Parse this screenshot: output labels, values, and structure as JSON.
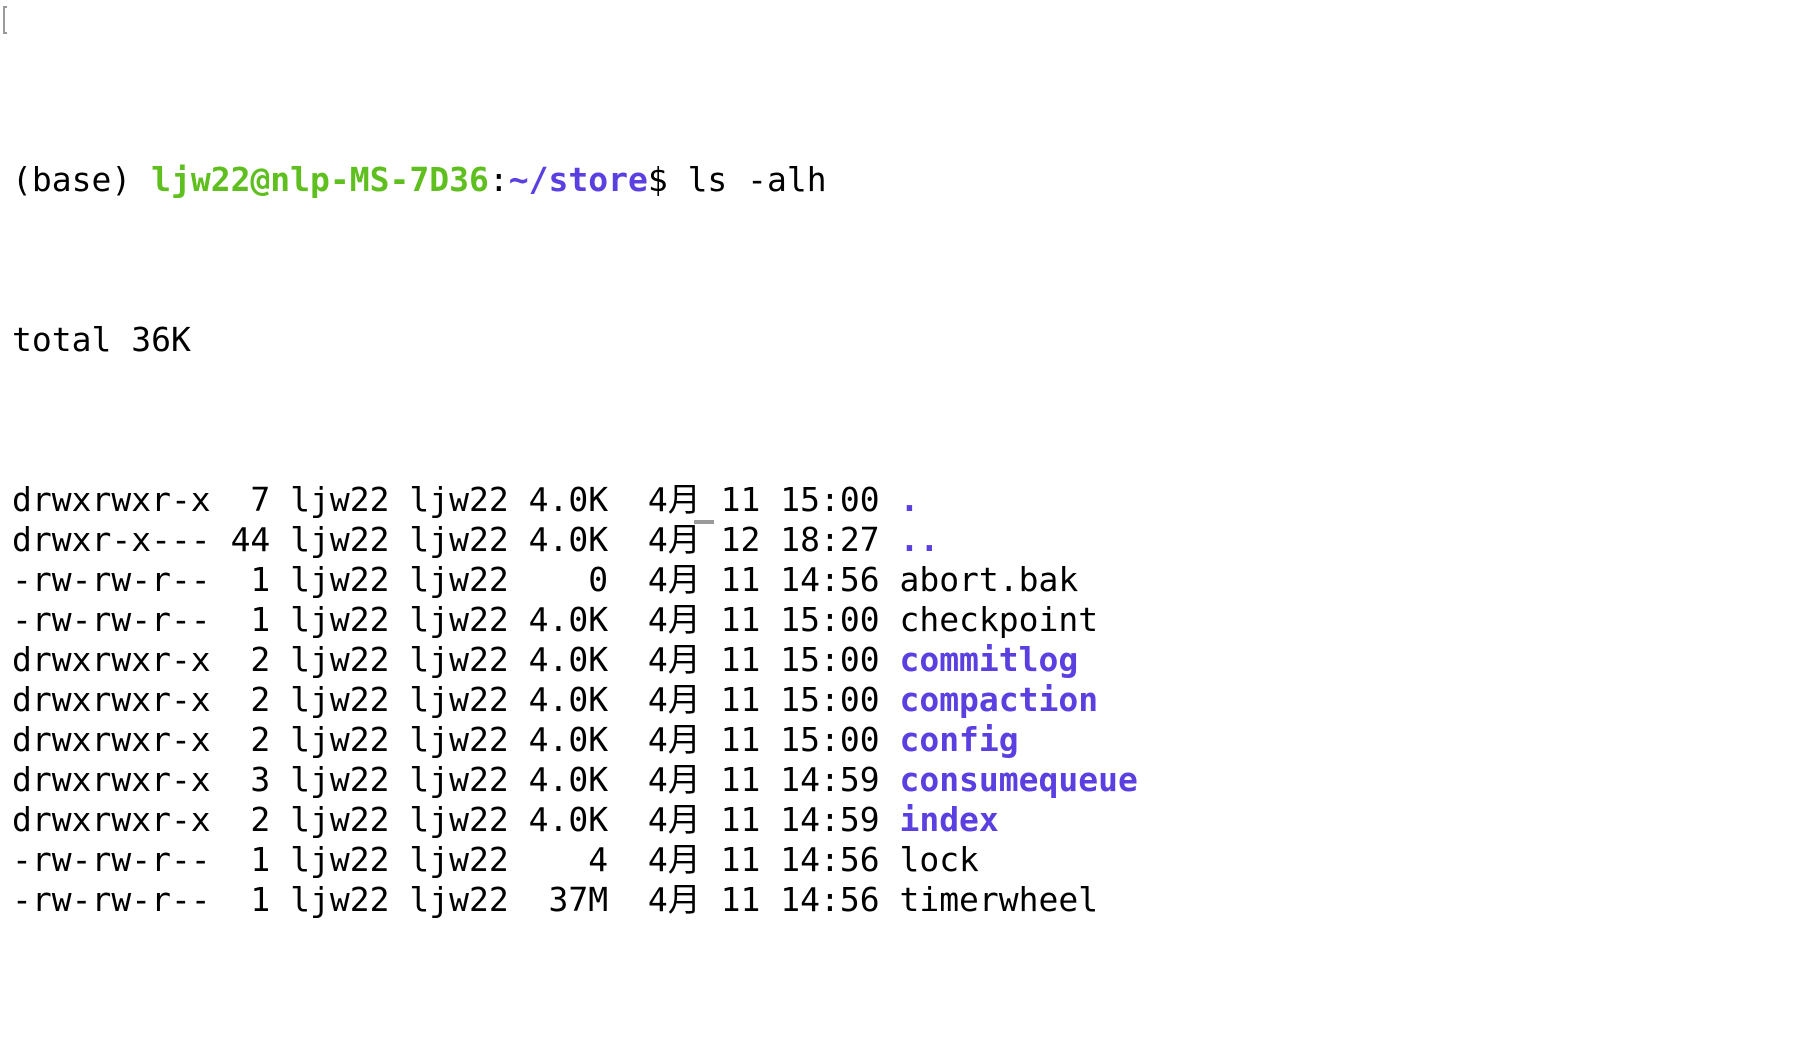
{
  "colors": {
    "prompt_user": "#5fbf1f",
    "prompt_path": "#5b3fe0",
    "directory": "#5b3fe0",
    "text": "#000000",
    "background": "#ffffff"
  },
  "prompt": {
    "env": "(base)",
    "user_host": "ljw22@nlp-MS-7D36",
    "separator": ":",
    "path": "~/store",
    "symbol": "$",
    "command": "ls -alh"
  },
  "total": "total 36K",
  "entries": [
    {
      "perms": "drwxrwxr-x",
      "links": "7",
      "owner": "ljw22",
      "group": "ljw22",
      "size": "4.0K",
      "month": "4月",
      "day": "11",
      "time": "15:00",
      "name": ".",
      "is_dir": true
    },
    {
      "perms": "drwxr-x---",
      "links": "44",
      "owner": "ljw22",
      "group": "ljw22",
      "size": "4.0K",
      "month": "4月",
      "day": "12",
      "time": "18:27",
      "name": "..",
      "is_dir": true
    },
    {
      "perms": "-rw-rw-r--",
      "links": "1",
      "owner": "ljw22",
      "group": "ljw22",
      "size": "0",
      "month": "4月",
      "day": "11",
      "time": "14:56",
      "name": "abort.bak",
      "is_dir": false
    },
    {
      "perms": "-rw-rw-r--",
      "links": "1",
      "owner": "ljw22",
      "group": "ljw22",
      "size": "4.0K",
      "month": "4月",
      "day": "11",
      "time": "15:00",
      "name": "checkpoint",
      "is_dir": false
    },
    {
      "perms": "drwxrwxr-x",
      "links": "2",
      "owner": "ljw22",
      "group": "ljw22",
      "size": "4.0K",
      "month": "4月",
      "day": "11",
      "time": "15:00",
      "name": "commitlog",
      "is_dir": true
    },
    {
      "perms": "drwxrwxr-x",
      "links": "2",
      "owner": "ljw22",
      "group": "ljw22",
      "size": "4.0K",
      "month": "4月",
      "day": "11",
      "time": "15:00",
      "name": "compaction",
      "is_dir": true
    },
    {
      "perms": "drwxrwxr-x",
      "links": "2",
      "owner": "ljw22",
      "group": "ljw22",
      "size": "4.0K",
      "month": "4月",
      "day": "11",
      "time": "15:00",
      "name": "config",
      "is_dir": true
    },
    {
      "perms": "drwxrwxr-x",
      "links": "3",
      "owner": "ljw22",
      "group": "ljw22",
      "size": "4.0K",
      "month": "4月",
      "day": "11",
      "time": "14:59",
      "name": "consumequeue",
      "is_dir": true
    },
    {
      "perms": "drwxrwxr-x",
      "links": "2",
      "owner": "ljw22",
      "group": "ljw22",
      "size": "4.0K",
      "month": "4月",
      "day": "11",
      "time": "14:59",
      "name": "index",
      "is_dir": true
    },
    {
      "perms": "-rw-rw-r--",
      "links": "1",
      "owner": "ljw22",
      "group": "ljw22",
      "size": "4",
      "month": "4月",
      "day": "11",
      "time": "14:56",
      "name": "lock",
      "is_dir": false
    },
    {
      "perms": "-rw-rw-r--",
      "links": "1",
      "owner": "ljw22",
      "group": "ljw22",
      "size": "37M",
      "month": "4月",
      "day": "11",
      "time": "14:56",
      "name": "timerwheel",
      "is_dir": false
    }
  ]
}
